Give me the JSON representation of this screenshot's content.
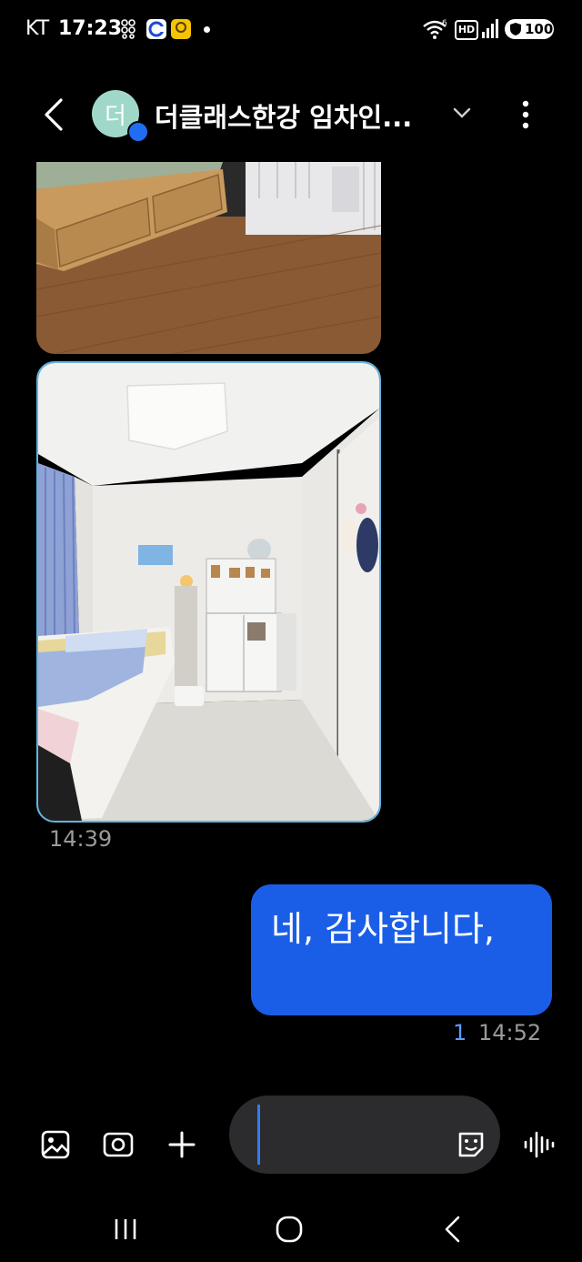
{
  "status_bar": {
    "carrier": "KT",
    "time": "17:23",
    "battery": "100",
    "network_badge": "HD"
  },
  "header": {
    "avatar_initial": "더",
    "title": "더클래스한강 임차인..."
  },
  "messages": {
    "received_time": "14:39",
    "sent_text": "네, 감사합니다,",
    "read_count": "1",
    "sent_time": "14:52"
  },
  "input": {
    "placeholder": ""
  },
  "icons": [
    "back-arrow-icon",
    "chevron-down-icon",
    "more-vert-icon",
    "gallery-icon",
    "camera-icon",
    "plus-icon",
    "emoji-sticker-icon",
    "voice-wave-icon",
    "nav-recents-icon",
    "nav-home-icon",
    "nav-back-icon"
  ],
  "colors": {
    "sent_bubble": "#1a5ee8",
    "read_count": "#5b9cff",
    "avatar": "#9fd8c8",
    "photo_border": "#5fb5e2"
  }
}
